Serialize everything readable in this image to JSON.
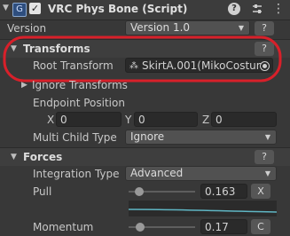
{
  "header": {
    "title": "VRC Phys Bone (Script)",
    "help_icon": "?",
    "presets_icon": "sliders-icon",
    "more_icon": "⋮"
  },
  "version": {
    "label": "Version",
    "value": "Version 1.0",
    "help": "?"
  },
  "transforms": {
    "title": "Transforms",
    "help": "?",
    "root_transform_label": "Root Transform",
    "root_transform_value": "SkirtA.001(MikoCostum",
    "ignore_transforms_label": "Ignore Transforms",
    "endpoint_label": "Endpoint Position",
    "x_label": "X",
    "x_value": "0",
    "y_label": "Y",
    "y_value": "0",
    "z_label": "Z",
    "z_value": "0",
    "multi_child_label": "Multi Child Type",
    "multi_child_value": "Ignore"
  },
  "forces": {
    "title": "Forces",
    "help": "?",
    "integration_label": "Integration Type",
    "integration_value": "Advanced",
    "pull_label": "Pull",
    "pull_value": "0.163",
    "pull_fraction": 0.163,
    "pull_button": "X",
    "momentum_label": "Momentum",
    "momentum_value": "0.17",
    "momentum_fraction": 0.17,
    "momentum_button": "C"
  },
  "colors": {
    "highlight": "#d8202a",
    "curve": "#5fb6c4"
  }
}
